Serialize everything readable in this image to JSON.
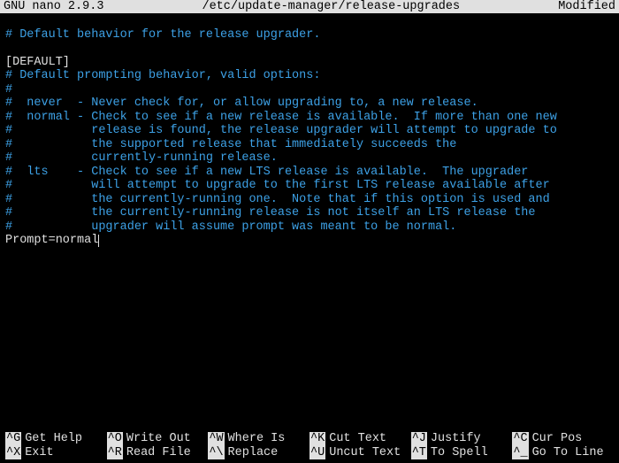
{
  "titlebar": {
    "app": "GNU nano 2.9.3",
    "file": "/etc/update-manager/release-upgrades",
    "status": "Modified"
  },
  "lines": [
    {
      "cls": "comment",
      "text": "# Default behavior for the release upgrader."
    },
    {
      "cls": "blank",
      "text": ""
    },
    {
      "cls": "plain",
      "text": "[DEFAULT]"
    },
    {
      "cls": "comment",
      "text": "# Default prompting behavior, valid options:"
    },
    {
      "cls": "comment",
      "text": "#"
    },
    {
      "cls": "comment",
      "text": "#  never  - Never check for, or allow upgrading to, a new release."
    },
    {
      "cls": "comment",
      "text": "#  normal - Check to see if a new release is available.  If more than one new"
    },
    {
      "cls": "comment",
      "text": "#           release is found, the release upgrader will attempt to upgrade to"
    },
    {
      "cls": "comment",
      "text": "#           the supported release that immediately succeeds the"
    },
    {
      "cls": "comment",
      "text": "#           currently-running release."
    },
    {
      "cls": "comment",
      "text": "#  lts    - Check to see if a new LTS release is available.  The upgrader"
    },
    {
      "cls": "comment",
      "text": "#           will attempt to upgrade to the first LTS release available after"
    },
    {
      "cls": "comment",
      "text": "#           the currently-running one.  Note that if this option is used and"
    },
    {
      "cls": "comment",
      "text": "#           the currently-running release is not itself an LTS release the"
    },
    {
      "cls": "comment",
      "text": "#           upgrader will assume prompt was meant to be normal."
    },
    {
      "cls": "plain",
      "text": "Prompt=normal",
      "cursor": true
    }
  ],
  "shortcuts": {
    "row1": [
      {
        "key": "^G",
        "label": "Get Help"
      },
      {
        "key": "^O",
        "label": "Write Out"
      },
      {
        "key": "^W",
        "label": "Where Is"
      },
      {
        "key": "^K",
        "label": "Cut Text"
      },
      {
        "key": "^J",
        "label": "Justify"
      },
      {
        "key": "^C",
        "label": "Cur Pos"
      }
    ],
    "row2": [
      {
        "key": "^X",
        "label": "Exit"
      },
      {
        "key": "^R",
        "label": "Read File"
      },
      {
        "key": "^\\",
        "label": "Replace"
      },
      {
        "key": "^U",
        "label": "Uncut Text"
      },
      {
        "key": "^T",
        "label": "To Spell"
      },
      {
        "key": "^_",
        "label": "Go To Line"
      }
    ]
  }
}
